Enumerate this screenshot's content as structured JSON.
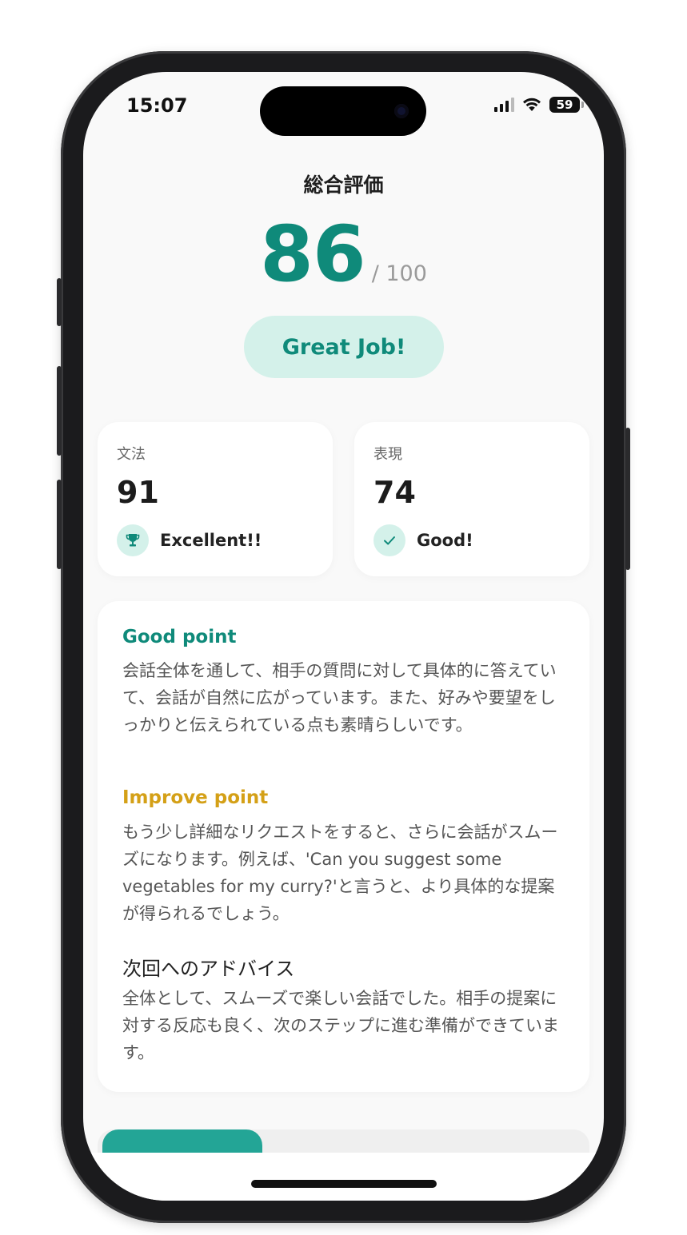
{
  "status_bar": {
    "time": "15:07",
    "battery": "59"
  },
  "header": {
    "title": "総合評価",
    "score": "86",
    "score_max": "/ 100",
    "badge": "Great Job!"
  },
  "stats": [
    {
      "label": "文法",
      "value": "91",
      "rating": "Excellent!!",
      "icon": "trophy-icon"
    },
    {
      "label": "表現",
      "value": "74",
      "rating": "Good!",
      "icon": "check-icon"
    }
  ],
  "feedback": {
    "good_title": "Good point",
    "good_text": "会話全体を通して、相手の質問に対して具体的に答えていて、会話が自然に広がっています。また、好みや要望をしっかりと伝えられている点も素晴らしいです。",
    "improve_title": "Improve point",
    "improve_text": "もう少し詳細なリクエストをすると、さらに会話がスムーズになります。例えば、'Can you suggest some vegetables for my curry?'と言うと、より具体的な提案が得られるでしょう。",
    "advice_title": "次回へのアドバイス",
    "advice_text": "全体として、スムーズで楽しい会話でした。相手の提案に対する反応も良く、次のステップに進む準備ができています。"
  },
  "colors": {
    "accent": "#0f8a7a",
    "accent_light": "#d4f1ea",
    "improve": "#d4a017",
    "background": "#f9f9f9"
  }
}
